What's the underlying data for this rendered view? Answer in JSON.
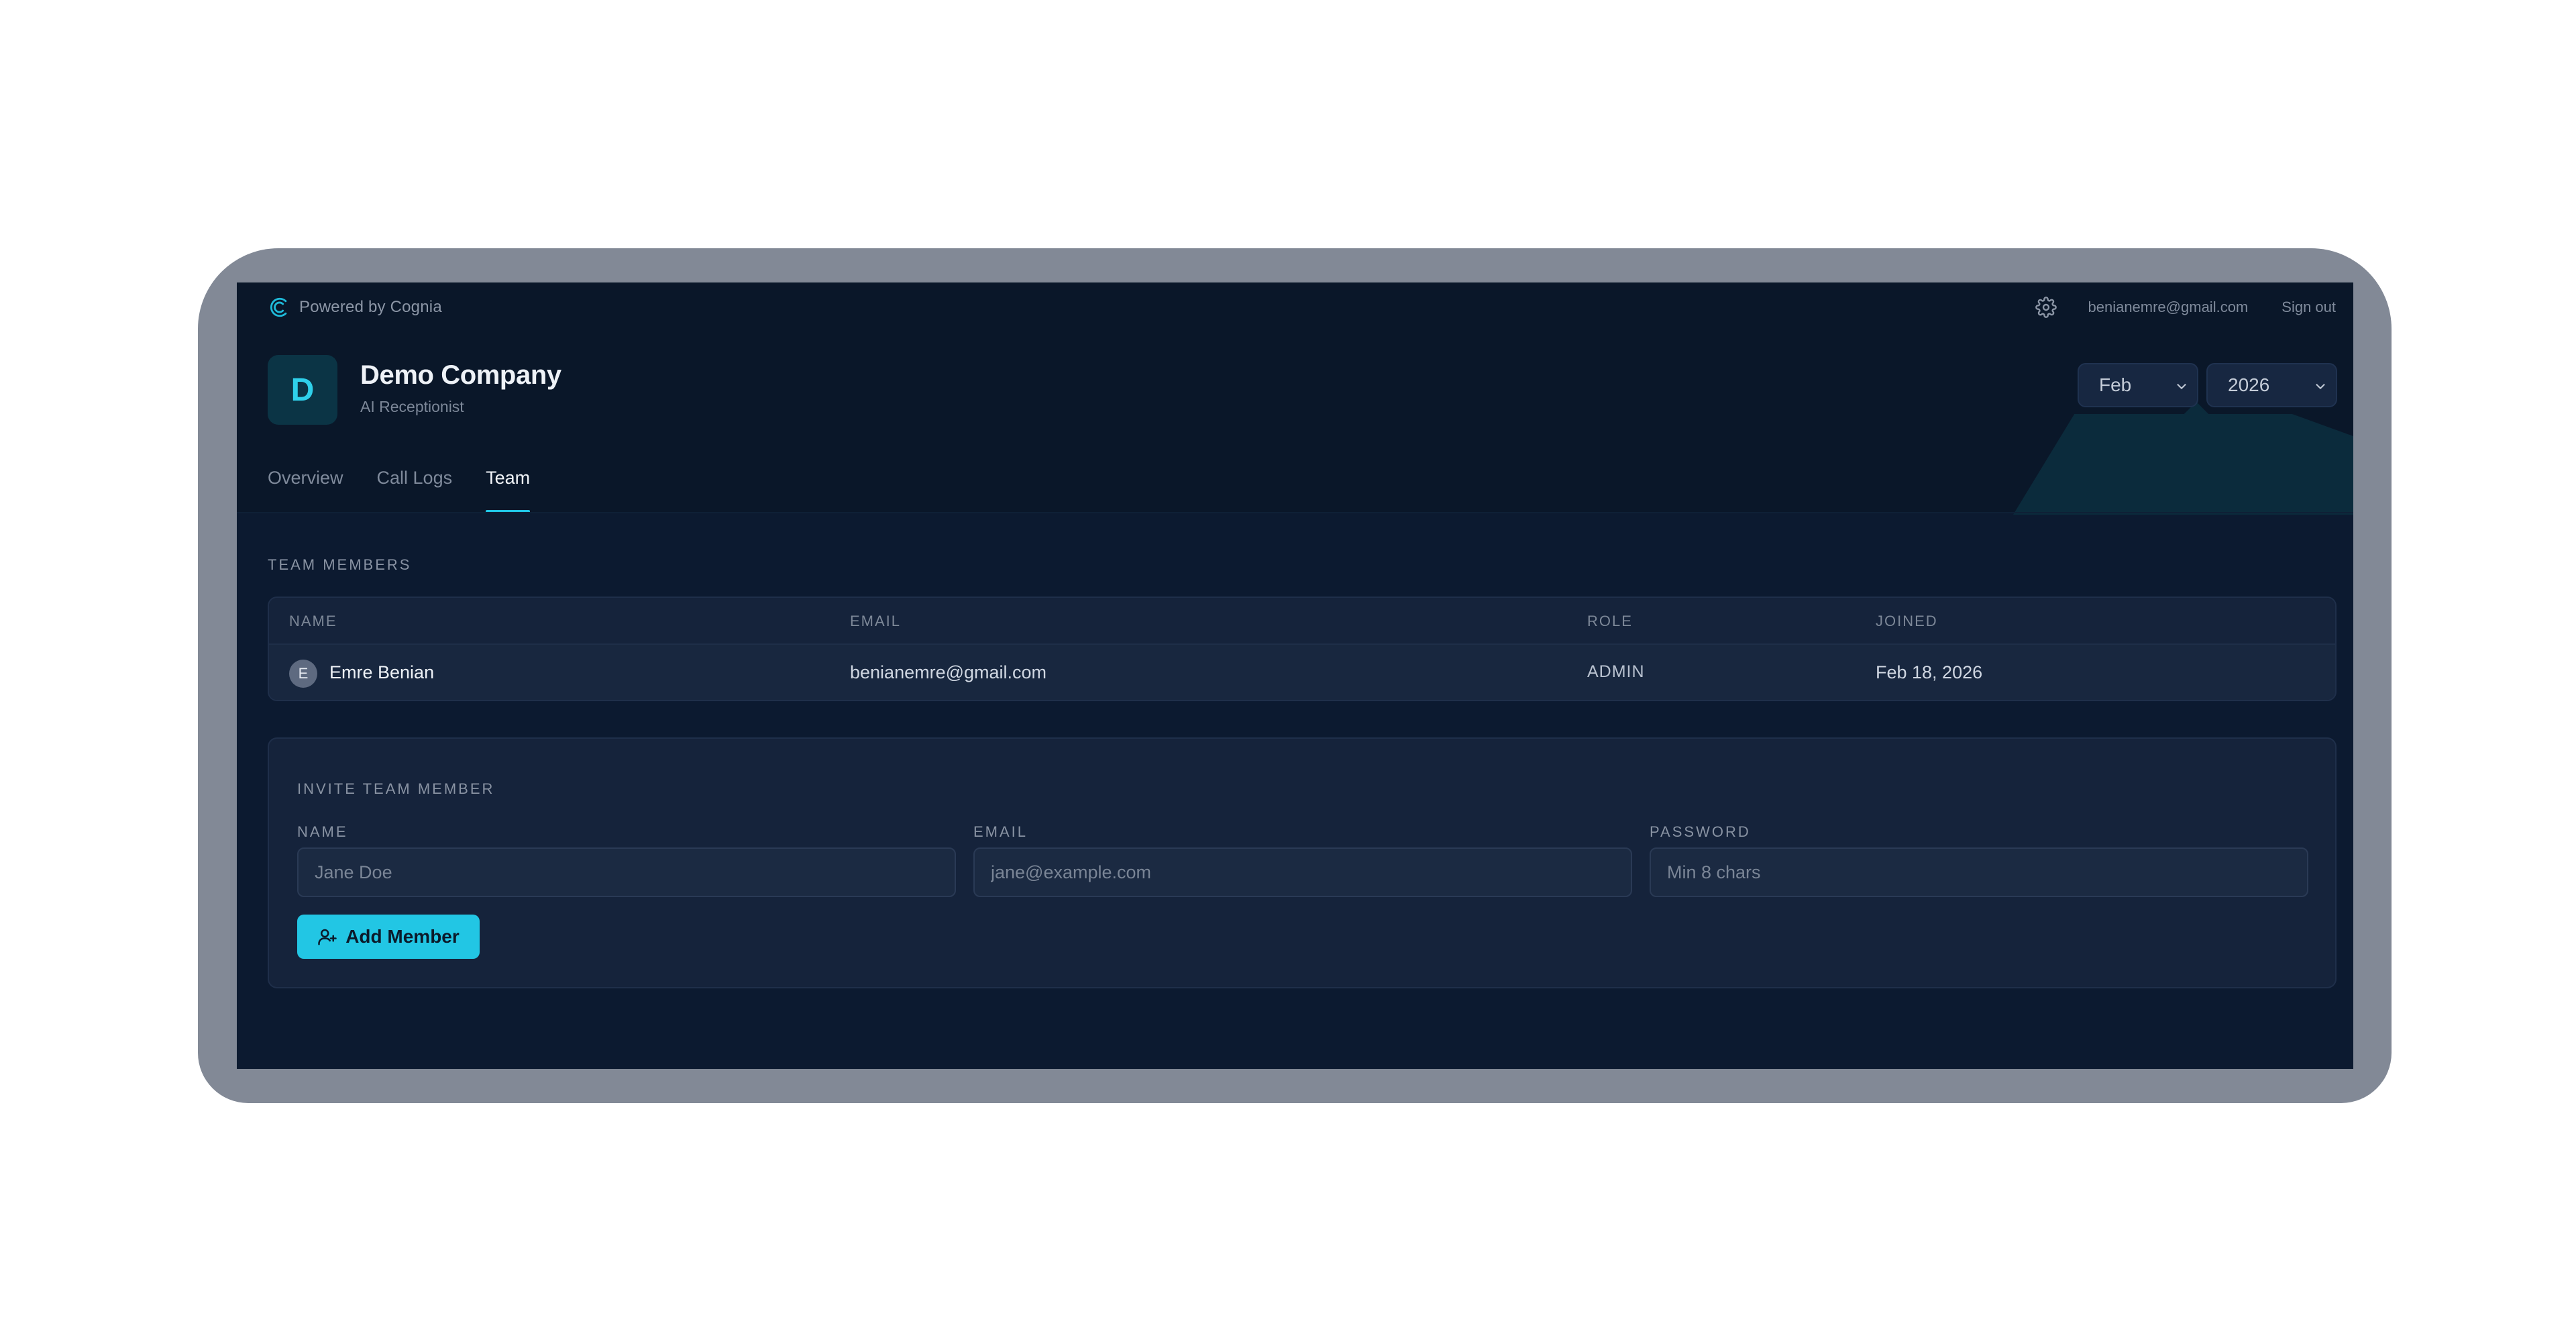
{
  "topbar": {
    "brand_text": "Powered by Cognia",
    "brand_icon": "cognia-logo-icon",
    "settings_icon": "gear-icon",
    "user_email": "benianemre@gmail.com",
    "sign_out_label": "Sign out"
  },
  "company": {
    "avatar_letter": "D",
    "name": "Demo Company",
    "subtitle": "AI Receptionist"
  },
  "filters": {
    "month": {
      "selected": "Feb",
      "icon": "chevron-down-icon"
    },
    "year": {
      "selected": "2026",
      "icon": "chevron-down-icon"
    }
  },
  "tabs": [
    {
      "label": "Overview",
      "active": false
    },
    {
      "label": "Call Logs",
      "active": false
    },
    {
      "label": "Team",
      "active": true
    }
  ],
  "team_members": {
    "section_title": "TEAM MEMBERS",
    "columns": [
      "NAME",
      "EMAIL",
      "ROLE",
      "JOINED"
    ],
    "rows": [
      {
        "avatar_letter": "E",
        "name": "Emre Benian",
        "email": "benianemre@gmail.com",
        "role": "ADMIN",
        "joined": "Feb 18, 2026"
      }
    ]
  },
  "invite": {
    "section_title": "INVITE TEAM MEMBER",
    "fields": [
      {
        "label": "NAME",
        "placeholder": "Jane Doe",
        "value": ""
      },
      {
        "label": "EMAIL",
        "placeholder": "jane@example.com",
        "value": ""
      },
      {
        "label": "PASSWORD",
        "placeholder": "Min 8 chars",
        "value": ""
      }
    ],
    "submit_label": "Add Member",
    "submit_icon": "user-plus-icon"
  },
  "colors": {
    "accent": "#22c6e4",
    "background": "#0c1a30",
    "surface": "#15233b",
    "frame": "#828996"
  }
}
